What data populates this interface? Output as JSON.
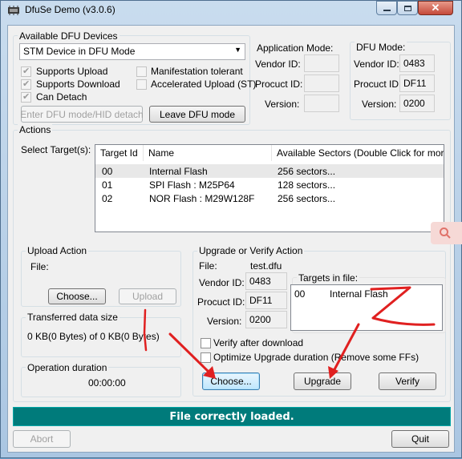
{
  "window": {
    "title": "DfuSe Demo (v3.0.6)"
  },
  "devices": {
    "group_label": "Available DFU Devices",
    "selected": "STM Device in DFU Mode",
    "supports_upload": "Supports Upload",
    "supports_download": "Supports Download",
    "can_detach": "Can Detach",
    "manifestation_tolerant": "Manifestation tolerant",
    "accelerated_upload": "Accelerated Upload (ST)",
    "enter_dfu_button": "Enter DFU mode/HID detach",
    "leave_dfu_button": "Leave DFU mode"
  },
  "app_mode": {
    "label": "Application Mode:",
    "vendor_id_label": "Vendor ID:",
    "product_id_label": "Procuct ID:",
    "version_label": "Version:",
    "vendor_id": "",
    "product_id": "",
    "version": ""
  },
  "dfu_mode": {
    "label": "DFU Mode:",
    "vendor_id_label": "Vendor ID:",
    "product_id_label": "Procuct ID:",
    "version_label": "Version:",
    "vendor_id": "0483",
    "product_id": "DF11",
    "version": "0200"
  },
  "actions": {
    "label": "Actions",
    "select_target_label": "Select Target(s):",
    "columns": [
      "Target Id",
      "Name",
      "Available Sectors (Double Click for more)"
    ],
    "rows": [
      {
        "id": "00",
        "name": "Internal Flash",
        "sectors": "256 sectors..."
      },
      {
        "id": "01",
        "name": "SPI Flash : M25P64",
        "sectors": "128 sectors..."
      },
      {
        "id": "02",
        "name": "NOR Flash : M29W128F",
        "sectors": "256 sectors..."
      }
    ]
  },
  "upload": {
    "label": "Upload Action",
    "file_label": "File:",
    "choose_button": "Choose...",
    "upload_button": "Upload"
  },
  "transferred": {
    "label": "Transferred data size",
    "value": "0 KB(0 Bytes) of 0 KB(0 Bytes)"
  },
  "duration": {
    "label": "Operation duration",
    "value": "00:00:00"
  },
  "upgrade": {
    "label": "Upgrade or Verify Action",
    "file_label": "File:",
    "file_value": "test.dfu",
    "vendor_id_label": "Vendor ID:",
    "product_id_label": "Procuct ID:",
    "version_label": "Version:",
    "vendor_id": "0483",
    "product_id": "DF11",
    "version": "0200",
    "targets_label": "Targets in file:",
    "targets": [
      {
        "id": "00",
        "name": "Internal Flash"
      }
    ],
    "verify_after_download": "Verify after download",
    "optimize_upgrade": "Optimize Upgrade duration (Remove some FFs)",
    "choose_button": "Choose...",
    "upgrade_button": "Upgrade",
    "verify_button": "Verify"
  },
  "status": {
    "message": "File correctly loaded."
  },
  "footer": {
    "abort_button": "Abort",
    "quit_button": "Quit"
  },
  "colors": {
    "status_bar": "#007b7b",
    "annotation": "#e02020",
    "selection": "#e8e8e8"
  }
}
